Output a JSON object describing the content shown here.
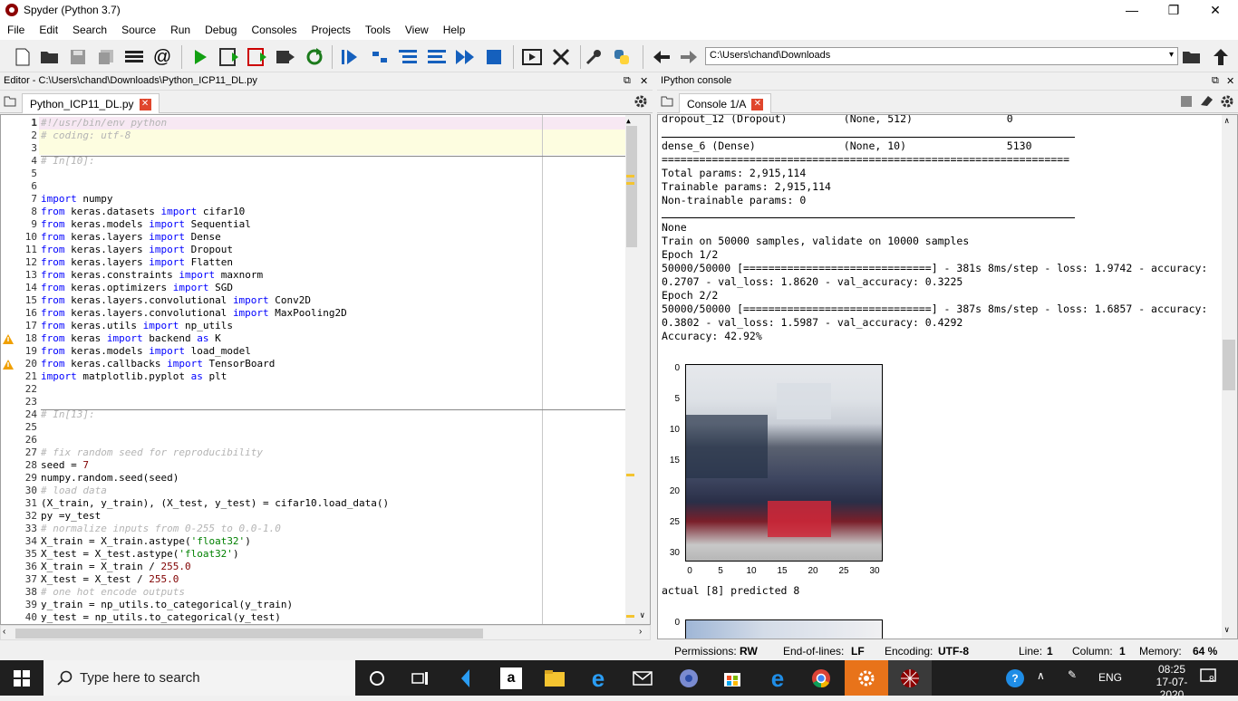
{
  "window": {
    "title": "Spyder (Python 3.7)",
    "minimize": "—",
    "maximize": "❐",
    "close": "✕"
  },
  "menu": [
    "File",
    "Edit",
    "Search",
    "Source",
    "Run",
    "Debug",
    "Consoles",
    "Projects",
    "Tools",
    "View",
    "Help"
  ],
  "toolbar": {
    "path": "C:\\Users\\chand\\Downloads"
  },
  "editor": {
    "header": "Editor - C:\\Users\\chand\\Downloads\\Python_ICP11_DL.py",
    "tab": "Python_ICP11_DL.py",
    "lines": [
      "#!/usr/bin/env python",
      "# coding: utf-8",
      "",
      "# In[10]:",
      "",
      "",
      "import numpy",
      "from keras.datasets import cifar10",
      "from keras.models import Sequential",
      "from keras.layers import Dense",
      "from keras.layers import Dropout",
      "from keras.layers import Flatten",
      "from keras.constraints import maxnorm",
      "from keras.optimizers import SGD",
      "from keras.layers.convolutional import Conv2D",
      "from keras.layers.convolutional import MaxPooling2D",
      "from keras.utils import np_utils",
      "from keras import backend as K",
      "from keras.models import load_model",
      "from keras.callbacks import TensorBoard",
      "import matplotlib.pyplot as plt",
      "",
      "",
      "# In[13]:",
      "",
      "",
      "# fix random seed for reproducibility",
      "seed = 7",
      "numpy.random.seed(seed)",
      "# load data",
      "(X_train, y_train), (X_test, y_test) = cifar10.load_data()",
      "py =y_test",
      "# normalize inputs from 0-255 to 0.0-1.0",
      "X_train = X_train.astype('float32')",
      "X_test = X_test.astype('float32')",
      "X_train = X_train / 255.0",
      "X_test = X_test / 255.0",
      "# one hot encode outputs",
      "y_train = np_utils.to_categorical(y_train)",
      "y_test = np_utils.to_categorical(y_test)"
    ]
  },
  "console": {
    "header": "IPython console",
    "tab": "Console 1/A",
    "lines": [
      "dropout_12 (Dropout)         (None, 512)               0",
      "",
      "dense_6 (Dense)              (None, 10)                5130",
      "=================================================================",
      "Total params: 2,915,114",
      "Trainable params: 2,915,114",
      "Non-trainable params: 0",
      "",
      "None",
      "Train on 50000 samples, validate on 10000 samples",
      "Epoch 1/2",
      "50000/50000 [==============================] - 381s 8ms/step - loss: 1.9742 - accuracy:",
      "0.2707 - val_loss: 1.8620 - val_accuracy: 0.3225",
      "Epoch 2/2",
      "50000/50000 [==============================] - 387s 8ms/step - loss: 1.6857 - accuracy:",
      "0.3802 - val_loss: 1.5987 - val_accuracy: 0.4292",
      "Accuracy: 42.92%"
    ],
    "plot_yticks": [
      "0",
      "5",
      "10",
      "15",
      "20",
      "25",
      "30"
    ],
    "plot_xticks": [
      "0",
      "5",
      "10",
      "15",
      "20",
      "25",
      "30"
    ],
    "prediction": "actual [8] predicted 8",
    "plot2_ytick": "0"
  },
  "status": {
    "permissions_label": "Permissions:",
    "permissions": "RW",
    "eol_label": "End-of-lines:",
    "eol": "LF",
    "encoding_label": "Encoding:",
    "encoding": "UTF-8",
    "line_label": "Line:",
    "line": "1",
    "column_label": "Column:",
    "column": "1",
    "memory_label": "Memory:",
    "memory": "64 %"
  },
  "taskbar": {
    "search_placeholder": "Type here to search",
    "lang": "ENG",
    "time": "08:25",
    "date": "17-07-2020",
    "notifications": "8"
  }
}
